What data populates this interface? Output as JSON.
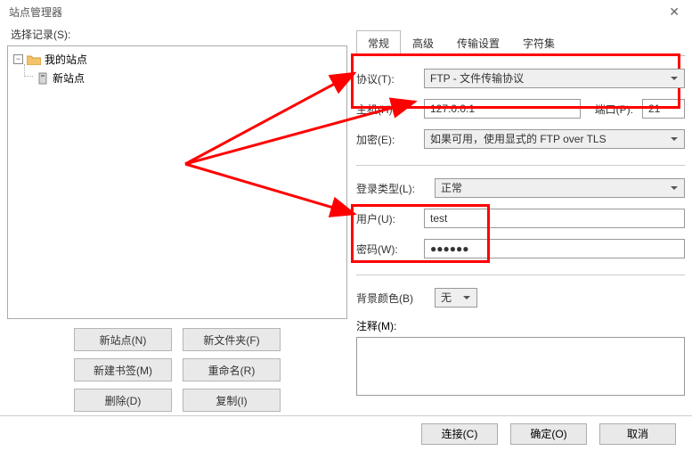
{
  "window": {
    "title": "站点管理器"
  },
  "left": {
    "label": "选择记录(S):",
    "root": "我的站点",
    "child": "新站点",
    "buttons": {
      "new_site": "新站点(N)",
      "new_folder": "新文件夹(F)",
      "new_bookmark": "新建书签(M)",
      "rename": "重命名(R)",
      "delete": "删除(D)",
      "copy": "复制(I)"
    }
  },
  "tabs": {
    "general": "常规",
    "advanced": "高级",
    "transfer": "传输设置",
    "charset": "字符集"
  },
  "form": {
    "protocol_label": "协议(T):",
    "protocol_value": "FTP - 文件传输协议",
    "host_label": "主机(H):",
    "host_value": "127.0.0.1",
    "port_label": "端口(P):",
    "port_value": "21",
    "encryption_label": "加密(E):",
    "encryption_value": "如果可用，使用显式的 FTP over TLS",
    "logon_label": "登录类型(L):",
    "logon_value": "正常",
    "user_label": "用户(U):",
    "user_value": "test",
    "pass_label": "密码(W):",
    "pass_value": "●●●●●●",
    "bgcolor_label": "背景颜色(B)",
    "bgcolor_value": "无",
    "comment_label": "注释(M):",
    "comment_value": ""
  },
  "footer": {
    "connect": "连接(C)",
    "ok": "确定(O)",
    "cancel": "取消"
  }
}
